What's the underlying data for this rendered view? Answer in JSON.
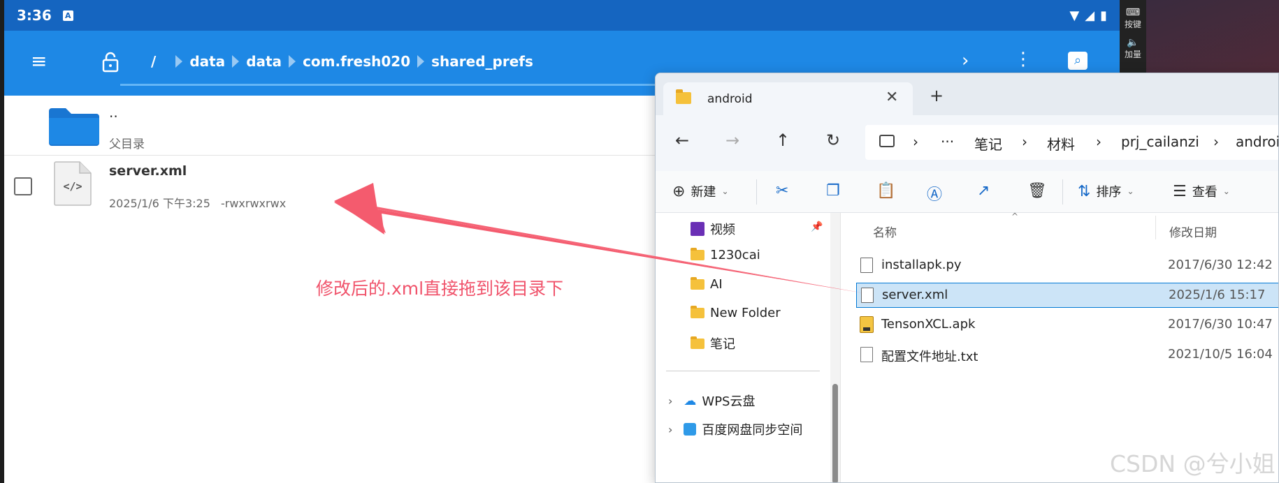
{
  "status_bar": {
    "time": "3:36",
    "badge": "A"
  },
  "emulator_bar": {
    "keys_label": "按键",
    "volume_label": "加量"
  },
  "file_manager": {
    "breadcrumb": {
      "root": "/",
      "segments": [
        "data",
        "data",
        "com.fresh020",
        "shared_prefs"
      ]
    },
    "parent_entry": {
      "name": "..",
      "subtitle": "父目录"
    },
    "file_entry": {
      "name": "server.xml",
      "date": "2025/1/6 下午3:25",
      "permissions": "-rwxrwxrwx"
    }
  },
  "annotation_text": "修改后的.xml直接拖到该目录下",
  "explorer": {
    "tab_title": "android",
    "address_parts": [
      "笔记",
      "材料",
      "prj_cailanzi",
      "android"
    ],
    "commands": {
      "new": "新建",
      "sort": "排序",
      "view": "查看"
    },
    "nav_items": [
      "视频",
      "1230cai",
      "AI",
      "New Folder",
      "笔记"
    ],
    "nav_items_bottom": [
      "WPS云盘",
      "百度网盘同步空间"
    ],
    "columns": {
      "name": "名称",
      "modified": "修改日期"
    },
    "files": [
      {
        "name": "installapk.py",
        "date": "2017/6/30 12:42"
      },
      {
        "name": "server.xml",
        "date": "2025/1/6 15:17"
      },
      {
        "name": "TensonXCL.apk",
        "date": "2017/6/30 10:47"
      },
      {
        "name": "配置文件地址.txt",
        "date": "2021/10/5 16:04"
      }
    ]
  },
  "watermark": "CSDN @兮小姐",
  "colors": {
    "status_bar": "#1565c0",
    "toolbar": "#1e88e5",
    "annotation": "#f0536b",
    "selection": "#cce4f7"
  }
}
